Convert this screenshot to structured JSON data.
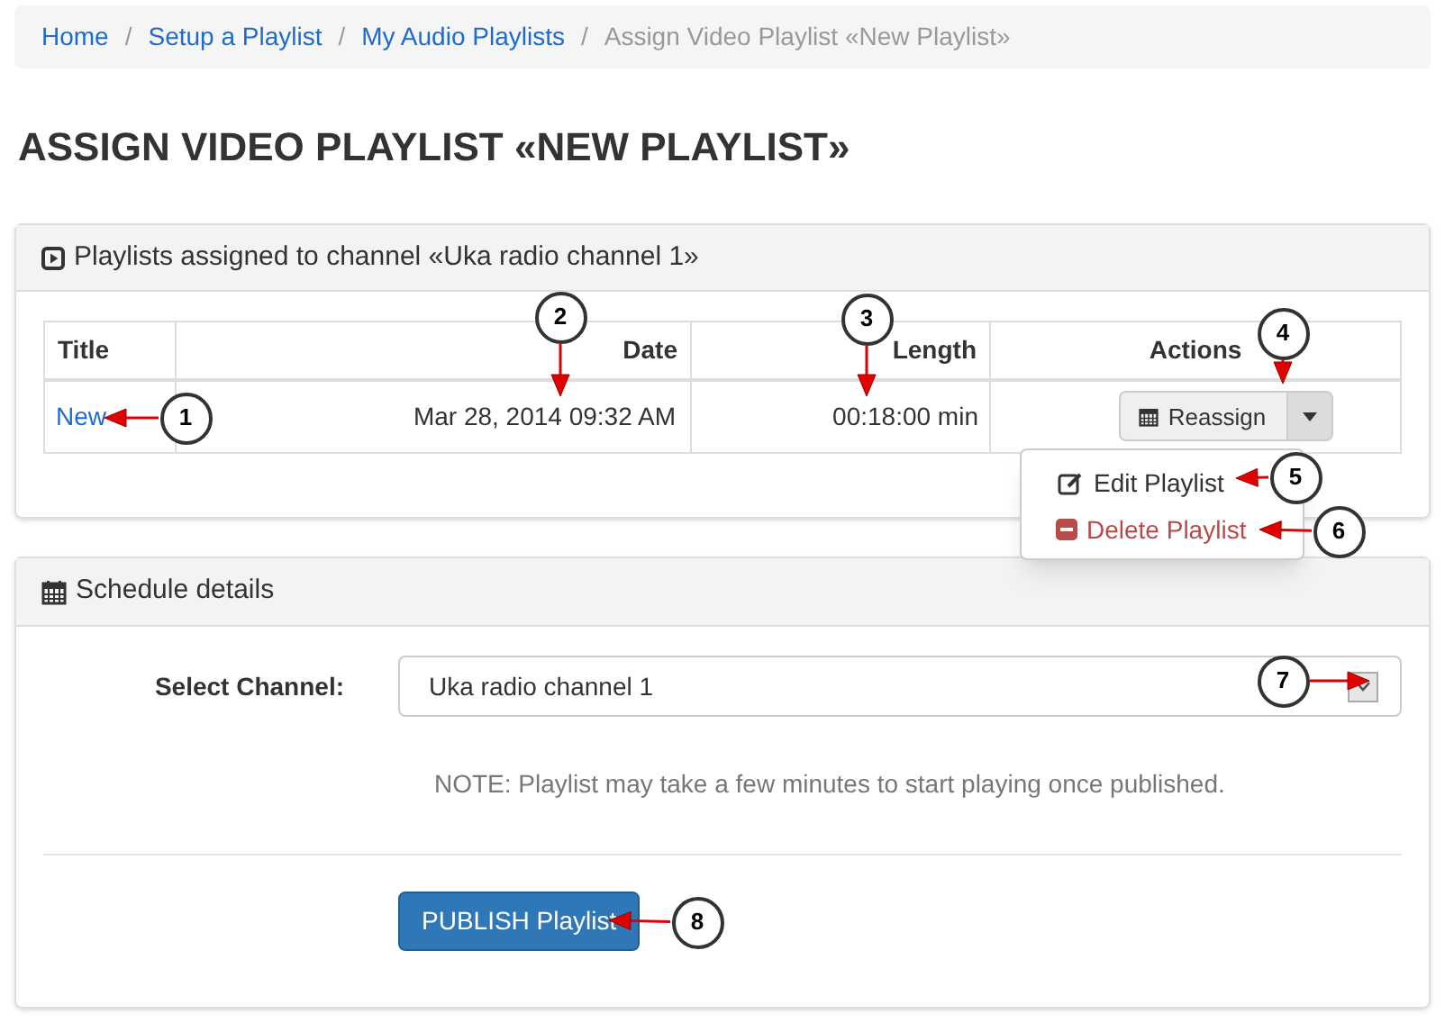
{
  "breadcrumb_separator": "/",
  "breadcrumb": [
    {
      "label": "Home",
      "current": false
    },
    {
      "label": "Setup a Playlist",
      "current": false
    },
    {
      "label": "My Audio Playlists",
      "current": false
    },
    {
      "label": "Assign Video Playlist «New Playlist»",
      "current": true
    }
  ],
  "heading": "ASSIGN VIDEO PLAYLIST «NEW PLAYLIST»",
  "playlists_panel": {
    "title": "Playlists assigned to channel «Uka radio channel 1»",
    "table": {
      "columns": [
        "Title",
        "Date",
        "Length",
        "Actions"
      ],
      "rows": [
        {
          "title": "New",
          "date": "Mar 28, 2014 09:32 AM",
          "length": "00:18:00 min",
          "action": "Reassign",
          "menu_expanded": true,
          "menu": [
            {
              "kind": "edit",
              "label": "Edit Playlist"
            },
            {
              "kind": "delete",
              "label": "Delete Playlist"
            }
          ]
        }
      ]
    }
  },
  "schedule_panel": {
    "title": "Schedule details",
    "channel_label": "Select Channel:",
    "channel_value": "Uka radio channel 1",
    "note": "NOTE: Playlist may take a few minutes to start playing once published.",
    "publish_button": "PUBLISH Playlist"
  },
  "callouts": [
    "1",
    "2",
    "3",
    "4",
    "5",
    "6",
    "7",
    "8"
  ]
}
